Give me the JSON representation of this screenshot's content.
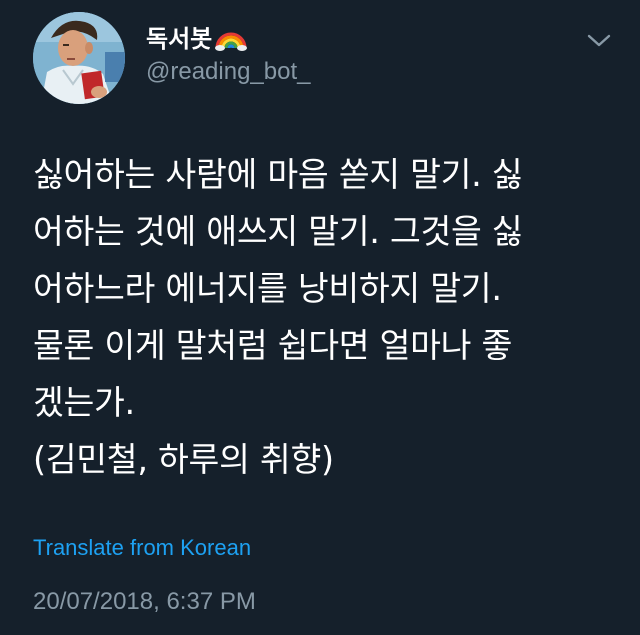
{
  "tweet": {
    "display_name": "독서봇",
    "name_emoji": "rainbow-icon",
    "handle": "@reading_bot_",
    "body_lines": [
      "싫어하는 사람에 마음 쏟지 말기. 싫",
      "어하는 것에 애쓰지 말기. 그것을 싫",
      "어하느라 에너지를 낭비하지 말기.",
      "물론 이게 말처럼 쉽다면 얼마나 좋",
      "겠는가.",
      "(김민철, 하루의 취향)"
    ],
    "translate_label": "Translate from Korean",
    "timestamp": "20/07/2018, 6:37 PM"
  },
  "colors": {
    "background": "#15202b",
    "text": "#ffffff",
    "secondary": "#8899a6",
    "link": "#1da1f2"
  }
}
